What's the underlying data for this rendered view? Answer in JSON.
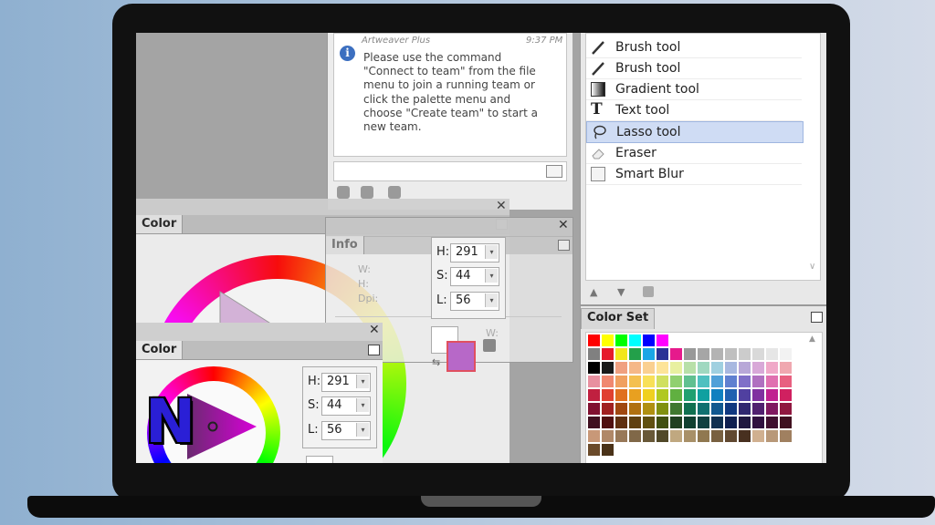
{
  "chat": {
    "sender": "Artweaver Plus",
    "time": "9:37 PM",
    "message": "Please use the command\n\"Connect to team\" from the file\nmenu to join a running team or\nclick the palette menu and\nchoose \"Create team\" to start a\nnew team."
  },
  "tools": {
    "items": [
      {
        "label": "Brush tool",
        "icon": "brush-icon"
      },
      {
        "label": "Brush tool",
        "icon": "brush-icon"
      },
      {
        "label": "Gradient tool",
        "icon": "gradient-icon"
      },
      {
        "label": "Text tool",
        "icon": "text-icon"
      },
      {
        "label": "Lasso tool",
        "icon": "lasso-icon",
        "selected": true
      },
      {
        "label": "Eraser",
        "icon": "eraser-icon"
      },
      {
        "label": "Smart Blur",
        "icon": "smart-blur-icon"
      }
    ]
  },
  "colorset": {
    "title": "Color Set",
    "swatches": [
      "#ff0000",
      "#ffff00",
      "#00ff00",
      "#00ffff",
      "#0000ff",
      "#ff00ff",
      "#ffffff",
      "#ffffff",
      "#ffffff",
      "#ffffff",
      "#ffffff",
      "#ffffff",
      "#ffffff",
      "#ffffff",
      "#ffffff",
      "#808080",
      "#e6192b",
      "#f2e61a",
      "#23a04a",
      "#1aa6e6",
      "#2a3296",
      "#e61a8c",
      "#999999",
      "#a6a6a6",
      "#b3b3b3",
      "#bfbfbf",
      "#cccccc",
      "#d9d9d9",
      "#e6e6e6",
      "#f2f2f2",
      "#000000",
      "#1a1a1a",
      "#f0a080",
      "#f5b888",
      "#fad090",
      "#fde498",
      "#e8f0a0",
      "#b8e0a8",
      "#a0d8c0",
      "#a0d0e0",
      "#a8b8e0",
      "#b8a8d8",
      "#d8a8d8",
      "#f0a8c8",
      "#f0a8b0",
      "#e890a0",
      "#f08870",
      "#f0a060",
      "#f4c050",
      "#f8e058",
      "#d0e060",
      "#90d070",
      "#60c090",
      "#50c0c0",
      "#50a0d8",
      "#6080d0",
      "#8070c8",
      "#b070c0",
      "#e070b0",
      "#e86080",
      "#c02040",
      "#e04030",
      "#e07020",
      "#e8a020",
      "#f0d020",
      "#b0c820",
      "#60b040",
      "#20a070",
      "#10a0a0",
      "#1080c0",
      "#2060b0",
      "#5040a0",
      "#8030a0",
      "#c02090",
      "#d02060",
      "#801030",
      "#a02020",
      "#a04810",
      "#b07010",
      "#b09010",
      "#809010",
      "#407830",
      "#107050",
      "#107070",
      "#105890",
      "#103880",
      "#302870",
      "#502070",
      "#801860",
      "#901840",
      "#401020",
      "#501010",
      "#603010",
      "#604010",
      "#605010",
      "#405010",
      "#204020",
      "#104030",
      "#104040",
      "#103050",
      "#102050",
      "#201840",
      "#301040",
      "#401030",
      "#401020",
      "#c89878",
      "#b08868",
      "#987858",
      "#806848",
      "#685838",
      "#504828",
      "#c0a880",
      "#a89068",
      "#907850",
      "#786040",
      "#604830",
      "#483020",
      "#d0b090",
      "#b89878",
      "#a08060",
      "#6a4a2a",
      "#4a3218"
    ]
  },
  "color_panel_back": {
    "tab": "Color",
    "h_label": "H:",
    "h_value": "291",
    "s_label": "S:",
    "s_value": "44",
    "l_label": "L:",
    "l_value": "56"
  },
  "info_panel": {
    "tab": "Info",
    "w_label": "W:",
    "h_label": "H:",
    "dpi_label": "Dpi:",
    "w2_label": "W:"
  },
  "color_panel_front": {
    "tab": "Color",
    "h_label": "H:",
    "h_value": "291",
    "s_label": "S:",
    "s_value": "44",
    "l_label": "L:",
    "l_value": "56"
  },
  "colors": {
    "current_color": "#b768c8",
    "accent_selection": "#cfdcf4"
  },
  "logo": {
    "letter": "N"
  }
}
